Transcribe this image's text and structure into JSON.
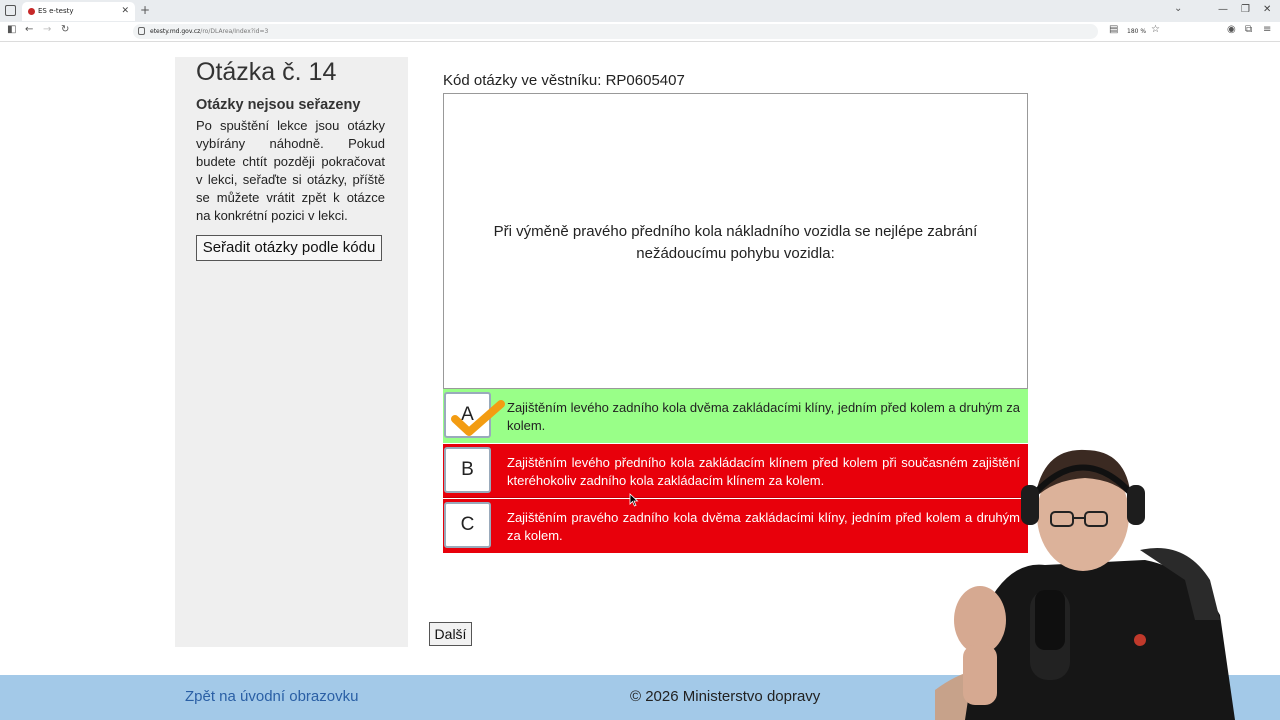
{
  "browser": {
    "tab_title": "ES e-testy",
    "url_host": "etesty.md.gov.cz",
    "url_path": "/ro/DLArea/Index?id=3",
    "zoom": "180 %"
  },
  "sidebar": {
    "question_title": "Otázka č. 14",
    "sort_heading": "Otázky nejsou seřazeny",
    "sort_description": "Po spuštění lekce jsou otázky vybírány náhodně. Pokud budete chtít později pokračovat v lekci, seřaďte si otázky, příště se můžete vrátit zpět k otázce na konkrétní pozici v lekci.",
    "sort_button": "Seřadit otázky podle kódu"
  },
  "question": {
    "code_label": "Kód otázky ve věstníku: RP0605407",
    "text": "Při výměně pravého předního kola nákladního vozidla se nejlépe zabrání nežádoucímu pohybu vozidla:"
  },
  "answers": [
    {
      "letter": "A",
      "text": "Zajištěním levého zadního kola dvěma zakládacími klíny, jedním před kolem a druhým za kolem.",
      "status": "correct",
      "color": "#99ff88"
    },
    {
      "letter": "B",
      "text": "Zajištěním levého předního kola zakládacím klínem před kolem při současném zajištění kteréhokoliv zadního kola zakládacím klínem za kolem.",
      "status": "wrong",
      "color": "#e8000b"
    },
    {
      "letter": "C",
      "text": "Zajištěním pravého zadního kola dvěma zakládacími klíny, jedním před kolem a druhým za kolem.",
      "status": "wrong",
      "color": "#e8000b"
    }
  ],
  "next_button": "Další",
  "footer": {
    "back_link": "Zpět na úvodní obrazovku",
    "copyright": "© 2026 Ministerstvo dopravy"
  }
}
